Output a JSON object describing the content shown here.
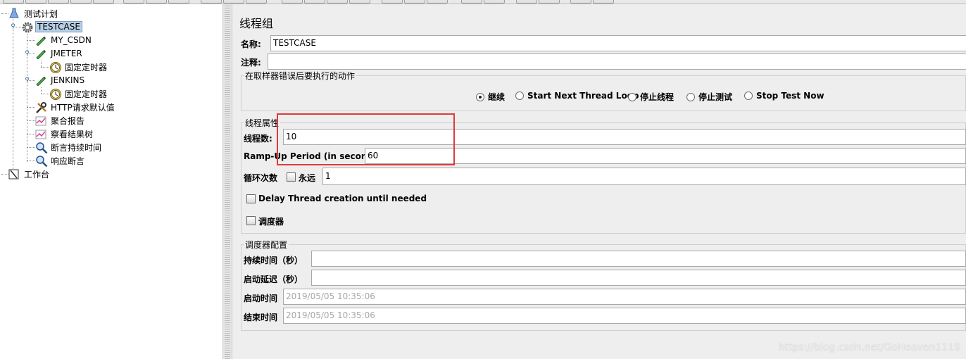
{
  "tree": {
    "test_plan": "测试计划",
    "thread_group": "TESTCASE",
    "items": [
      {
        "label": "MY_CSDN",
        "icon": "sampler-pen-icon"
      },
      {
        "label": "JMETER",
        "icon": "sampler-pen-icon"
      },
      {
        "label": "固定定时器",
        "icon": "timer-clock-icon"
      },
      {
        "label": "JENKINS",
        "icon": "sampler-pen-icon"
      },
      {
        "label": "固定定时器",
        "icon": "timer-clock-icon"
      },
      {
        "label": "HTTP请求默认值",
        "icon": "tools-icon"
      },
      {
        "label": "聚合报告",
        "icon": "graph-icon"
      },
      {
        "label": "察看结果树",
        "icon": "graph-icon"
      },
      {
        "label": "断言持续时间",
        "icon": "magnifier-icon"
      },
      {
        "label": "响应断言",
        "icon": "magnifier-icon"
      }
    ],
    "workbench": "工作台"
  },
  "panel": {
    "title": "线程组",
    "name_label": "名称:",
    "name_value": "TESTCASE",
    "comment_label": "注释:",
    "comment_value": "",
    "error_group_title": "在取样器错误后要执行的动作",
    "error_actions": [
      "继续",
      "Start Next Thread Loop",
      "停止线程",
      "停止测试",
      "Stop Test Now"
    ],
    "error_selected": "继续",
    "props_title": "线程属性",
    "threads_label": "线程数:",
    "threads_value": "10",
    "rampup_label": "Ramp-Up Period (in seconds):",
    "rampup_value": "60",
    "loop_label": "循环次数",
    "forever_label": "永远",
    "loop_value": "1",
    "delay_label": "Delay Thread creation until needed",
    "scheduler_label": "调度器",
    "sched_group_title": "调度器配置",
    "duration_label": "持续时间（秒）",
    "duration_value": "",
    "delay_start_label": "启动延迟（秒）",
    "delay_start_value": "",
    "start_label": "启动时间",
    "start_value": "2019/05/05 10:35:06",
    "end_label": "结束时间",
    "end_value": "2019/05/05 10:35:06"
  },
  "watermark": "https://blog.csdn.net/GoHeaven1119",
  "colors": {
    "highlight_box": "#e03a3a",
    "selected_node": "#b8cfe5"
  }
}
